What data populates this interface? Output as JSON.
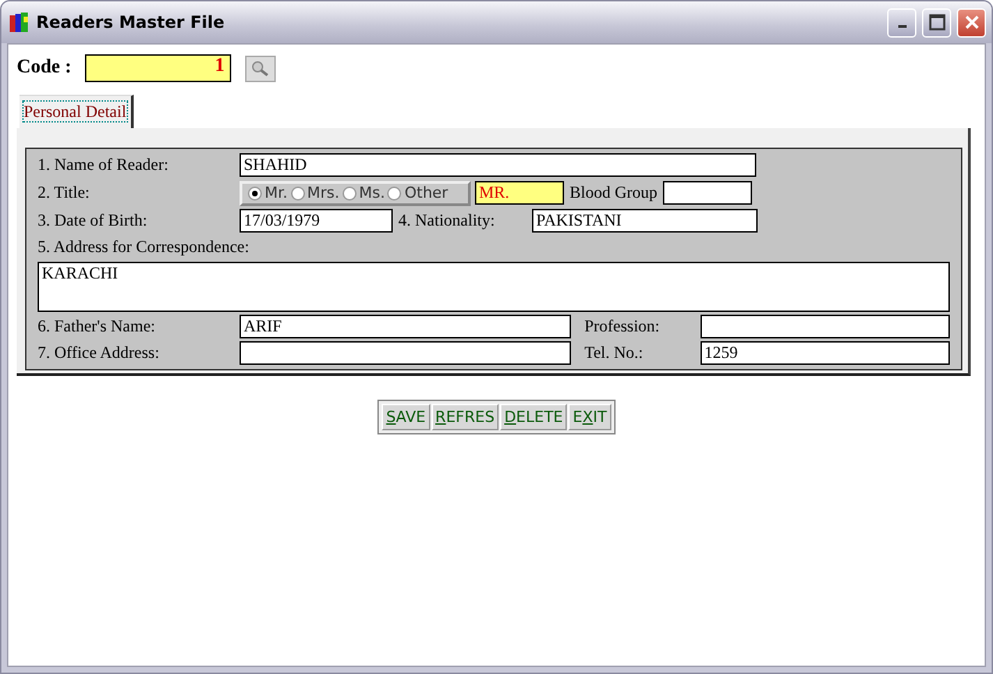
{
  "window": {
    "title": "Readers Master File"
  },
  "code": {
    "label": "Code :",
    "value": "1"
  },
  "tabs": [
    {
      "label": "Personal Detail",
      "selected": true
    }
  ],
  "form": {
    "name": {
      "label": "1. Name of Reader:",
      "value": "SHAHID"
    },
    "title": {
      "label": "2. Title:",
      "options": [
        {
          "label": "Mr.",
          "selected": true
        },
        {
          "label": "Mrs.",
          "selected": false
        },
        {
          "label": "Ms.",
          "selected": false
        },
        {
          "label": "Other",
          "selected": false
        }
      ],
      "value": "MR."
    },
    "blood_group": {
      "label": "Blood Group"
    },
    "dob": {
      "label": "3. Date of Birth:",
      "value": "17/03/1979"
    },
    "nationality": {
      "label": "4. Nationality:",
      "value": "PAKISTANI"
    },
    "address": {
      "label": "5. Address for Correspondence:",
      "value": "KARACHI"
    },
    "father": {
      "label": "6. Father's Name:",
      "value": "ARIF"
    },
    "profession": {
      "label": "Profession:"
    },
    "office": {
      "label": "7. Office Address:"
    },
    "tel": {
      "label": "Tel. No.:",
      "value": "1259"
    }
  },
  "buttons": [
    {
      "key": "S",
      "rest": "AVE"
    },
    {
      "key": "R",
      "rest": "EFRES"
    },
    {
      "key": "D",
      "rest": "ELETE"
    },
    {
      "before": "E",
      "key": "X",
      "rest": "IT"
    }
  ]
}
